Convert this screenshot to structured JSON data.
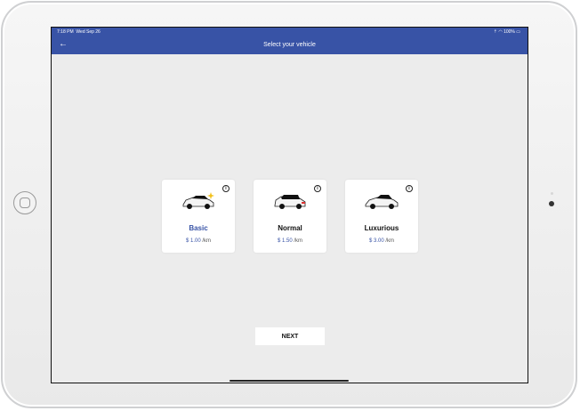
{
  "status_bar": {
    "time": "7:18 PM",
    "date": "Wed Sep 26",
    "battery": "100%"
  },
  "app_bar": {
    "back_icon": "arrow-left-icon",
    "title": "Select your vehicle"
  },
  "vehicles": [
    {
      "name": "Basic",
      "price": "$ 1.00",
      "unit": "/km",
      "selected": true
    },
    {
      "name": "Normal",
      "price": "$ 1.50",
      "unit": "/km",
      "selected": false
    },
    {
      "name": "Luxurious",
      "price": "$ 3.00",
      "unit": "/km",
      "selected": false
    }
  ],
  "next_button": {
    "label": "NEXT"
  },
  "colors": {
    "primary": "#3853a6",
    "background": "#ececec",
    "card": "#ffffff"
  }
}
